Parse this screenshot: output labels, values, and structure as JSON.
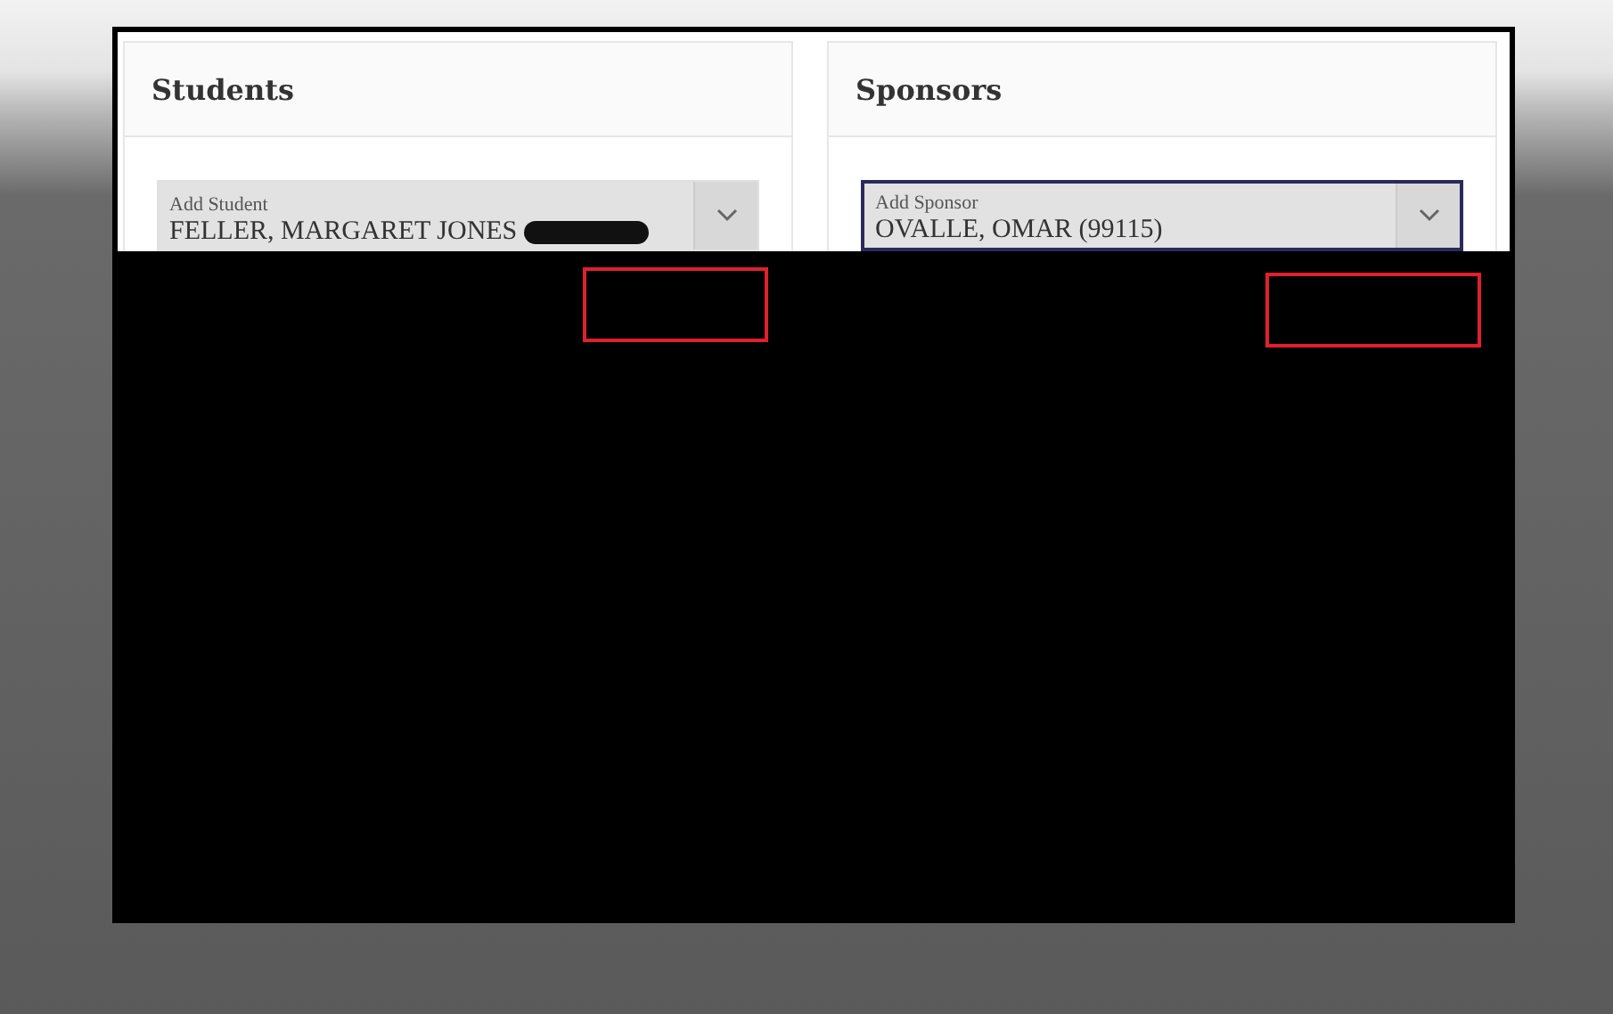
{
  "cards": [
    {
      "title": "Students",
      "field": {
        "label": "Add Student",
        "value": "FELLER, MARGARET JONES",
        "focused": false,
        "redacted": true
      }
    },
    {
      "title": "Sponsors",
      "field": {
        "label": "Add Sponsor",
        "value": "OVALLE, OMAR (99115)",
        "focused": true,
        "redacted": false
      }
    }
  ]
}
